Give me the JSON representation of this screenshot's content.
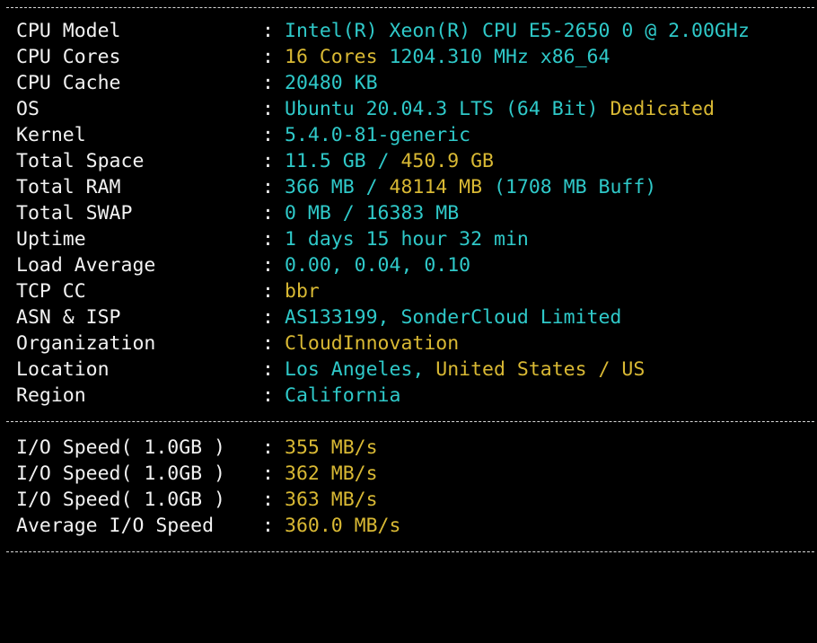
{
  "colors": {
    "background": "#000000",
    "label": "#f2f2f2",
    "cyan": "#2fc9c9",
    "yellow": "#d9b934"
  },
  "rows": [
    {
      "label": "CPU Model",
      "segments": [
        {
          "text": "Intel(R) Xeon(R) CPU E5-2650 0 @ 2.00GHz",
          "color": "cyan"
        }
      ]
    },
    {
      "label": "CPU Cores",
      "segments": [
        {
          "text": "16 Cores",
          "color": "yellow"
        },
        {
          "text": " 1204.310 MHz x86_64",
          "color": "cyan"
        }
      ]
    },
    {
      "label": "CPU Cache",
      "segments": [
        {
          "text": "20480 KB",
          "color": "cyan"
        }
      ]
    },
    {
      "label": "OS",
      "segments": [
        {
          "text": "Ubuntu 20.04.3 LTS (64 Bit)",
          "color": "cyan"
        },
        {
          "text": " Dedicated",
          "color": "yellow"
        }
      ]
    },
    {
      "label": "Kernel",
      "segments": [
        {
          "text": "5.4.0-81-generic",
          "color": "cyan"
        }
      ]
    },
    {
      "label": "Total Space",
      "segments": [
        {
          "text": "11.5 GB / ",
          "color": "cyan"
        },
        {
          "text": "450.9 GB",
          "color": "yellow"
        }
      ]
    },
    {
      "label": "Total RAM",
      "segments": [
        {
          "text": "366 MB / ",
          "color": "cyan"
        },
        {
          "text": "48114 MB",
          "color": "yellow"
        },
        {
          "text": " (1708 MB Buff)",
          "color": "cyan"
        }
      ]
    },
    {
      "label": "Total SWAP",
      "segments": [
        {
          "text": "0 MB / 16383 MB",
          "color": "cyan"
        }
      ]
    },
    {
      "label": "Uptime",
      "segments": [
        {
          "text": "1 days 15 hour 32 min",
          "color": "cyan"
        }
      ]
    },
    {
      "label": "Load Average",
      "segments": [
        {
          "text": "0.00, 0.04, 0.10",
          "color": "cyan"
        }
      ]
    },
    {
      "label": "TCP CC",
      "segments": [
        {
          "text": "bbr",
          "color": "yellow"
        }
      ]
    },
    {
      "label": "ASN & ISP",
      "segments": [
        {
          "text": "AS133199, SonderCloud Limited",
          "color": "cyan"
        }
      ]
    },
    {
      "label": "Organization",
      "segments": [
        {
          "text": "CloudInnovation",
          "color": "yellow"
        }
      ]
    },
    {
      "label": "Location",
      "segments": [
        {
          "text": "Los Angeles, ",
          "color": "cyan"
        },
        {
          "text": "United States / US",
          "color": "yellow"
        }
      ]
    },
    {
      "label": "Region",
      "segments": [
        {
          "text": "California",
          "color": "cyan"
        }
      ]
    }
  ],
  "io_rows": [
    {
      "label": "I/O Speed( 1.0GB )",
      "segments": [
        {
          "text": "355 MB/s",
          "color": "yellow"
        }
      ]
    },
    {
      "label": "I/O Speed( 1.0GB )",
      "segments": [
        {
          "text": "362 MB/s",
          "color": "yellow"
        }
      ]
    },
    {
      "label": "I/O Speed( 1.0GB )",
      "segments": [
        {
          "text": "363 MB/s",
          "color": "yellow"
        }
      ]
    },
    {
      "label": "Average I/O Speed",
      "segments": [
        {
          "text": "360.0 MB/s",
          "color": "yellow"
        }
      ]
    }
  ],
  "colon_char": ":"
}
